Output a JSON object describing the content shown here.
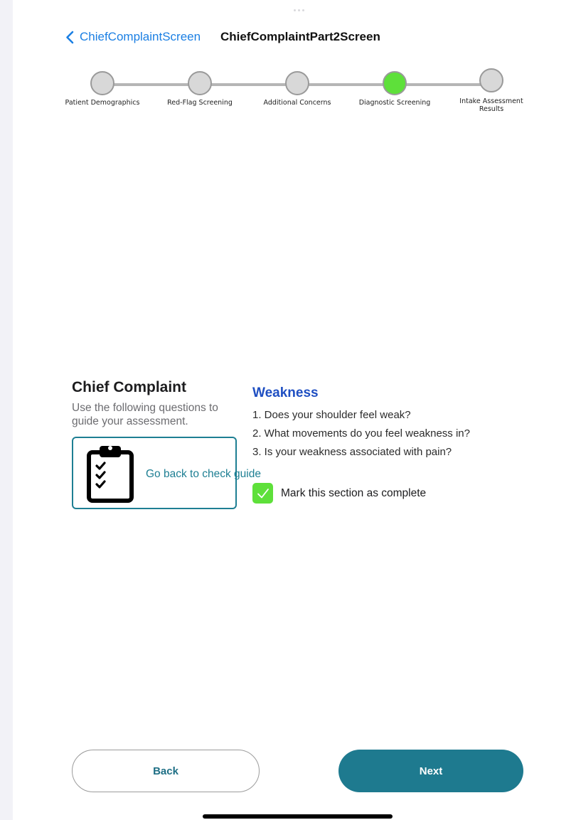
{
  "nav": {
    "back_label": "ChiefComplaintScreen",
    "title": "ChiefComplaintPart2Screen"
  },
  "stepper": {
    "steps": [
      {
        "label": "Patient Demographics",
        "active": false
      },
      {
        "label": "Red-Flag Screening",
        "active": false
      },
      {
        "label": "Additional Concerns",
        "active": false
      },
      {
        "label": "Diagnostic Screening",
        "active": true
      },
      {
        "label": "Intake Assessment Results",
        "active": false
      }
    ]
  },
  "chief_complaint": {
    "title": "Chief Complaint",
    "subtitle": "Use the following questions to guide your assessment.",
    "guide_link": "Go back to check guide"
  },
  "section": {
    "title": "Weakness",
    "questions": [
      "1. Does your shoulder feel weak?",
      "2. What movements do you feel weakness in?",
      "3. Is your weakness associated with pain?"
    ],
    "complete_label": "Mark this section as complete",
    "complete_checked": true
  },
  "footer": {
    "back_label": "Back",
    "next_label": "Next"
  },
  "colors": {
    "link_blue": "#1b7fe3",
    "teal": "#1e7a8f",
    "active_step": "#5ee03a",
    "section_title": "#1f4fc2"
  },
  "icons": [
    "chevron-left-icon",
    "clipboard-checklist-icon",
    "checkmark-icon"
  ]
}
